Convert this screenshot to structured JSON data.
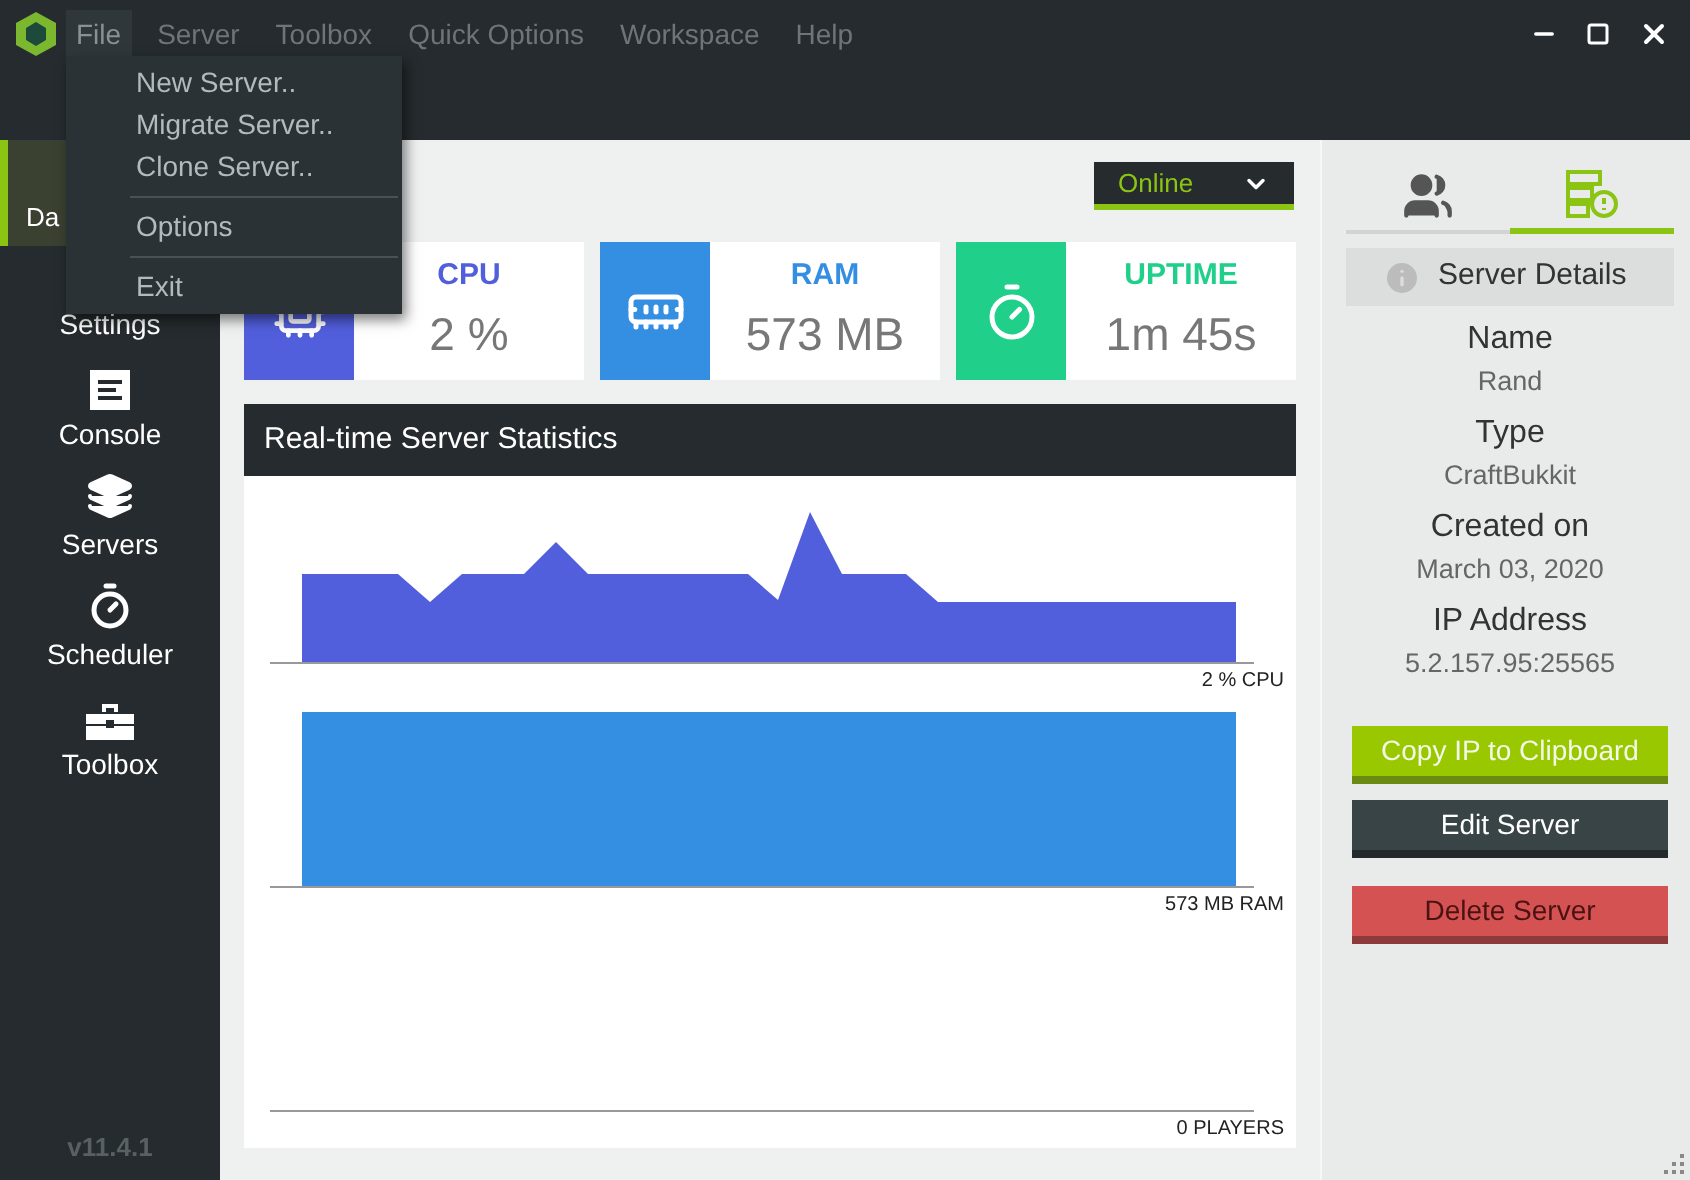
{
  "menu_bar": [
    {
      "label": "File",
      "selected": true
    },
    {
      "label": "Server",
      "selected": false
    },
    {
      "label": "Toolbox",
      "selected": false
    },
    {
      "label": "Quick Options",
      "selected": false
    },
    {
      "label": "Workspace",
      "selected": false
    },
    {
      "label": "Help",
      "selected": false
    }
  ],
  "file_menu": [
    {
      "kind": "item",
      "label": "New Server.."
    },
    {
      "kind": "item",
      "label": "Migrate Server.."
    },
    {
      "kind": "item",
      "label": "Clone Server.."
    },
    {
      "kind": "separator"
    },
    {
      "kind": "item",
      "label": "Options"
    },
    {
      "kind": "separator"
    },
    {
      "kind": "item",
      "label": "Exit"
    }
  ],
  "sidebar": {
    "items": [
      {
        "label": "Da",
        "selected": true
      },
      {
        "label": "Settings",
        "selected": false
      },
      {
        "label": "Console",
        "selected": false
      },
      {
        "label": "Servers",
        "selected": false
      },
      {
        "label": "Scheduler",
        "selected": false
      },
      {
        "label": "Toolbox",
        "selected": false
      }
    ],
    "version": "v11.4.1"
  },
  "status_select": {
    "value": "Online"
  },
  "stat_cards": [
    {
      "title": "CPU",
      "value": "2 %",
      "color": "#525fdc"
    },
    {
      "title": "RAM",
      "value": "573 MB",
      "color": "#348fe2"
    },
    {
      "title": "UPTIME",
      "value": "1m 45s",
      "color": "#1fcf8a"
    }
  ],
  "statistics": {
    "title": "Real-time Server Statistics",
    "charts": [
      {
        "label": "2 % CPU",
        "color": "#525fdc"
      },
      {
        "label": "573 MB RAM",
        "color": "#348fe2"
      },
      {
        "label": "0 PLAYERS"
      }
    ]
  },
  "right_panel": {
    "tabs": [
      {
        "selected": false
      },
      {
        "selected": true
      }
    ],
    "details_title": "Server Details",
    "details": [
      {
        "label": "Name",
        "value": "Rand"
      },
      {
        "label": "Type",
        "value": "CraftBukkit"
      },
      {
        "label": "Created on",
        "value": "March 03, 2020"
      },
      {
        "label": "IP Address",
        "value": "5.2.157.95:25565"
      }
    ],
    "buttons": [
      {
        "label": "Copy IP to Clipboard",
        "kind": "primary"
      },
      {
        "label": "Edit Server",
        "kind": "secondary"
      },
      {
        "label": "Delete Server",
        "kind": "danger"
      }
    ]
  }
}
